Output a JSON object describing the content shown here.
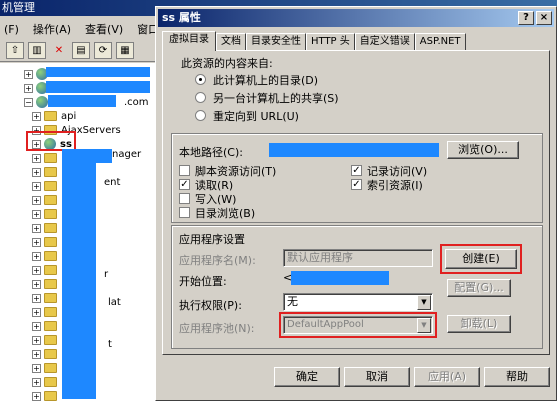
{
  "bg_window": {
    "title": "机管理",
    "menu": [
      "(F)",
      "操作(A)",
      "查看(V)",
      "窗口("
    ],
    "tree": {
      "domain_suffix": ".com",
      "items": [
        "api",
        "AjaxServers",
        "ss",
        "nager",
        "ent",
        "r",
        "lat",
        "t"
      ]
    }
  },
  "dialog": {
    "title": "ss 属性",
    "help_btn": "?",
    "close_btn": "×",
    "tabs": [
      "虚拟目录",
      "文档",
      "目录安全性",
      "HTTP 头",
      "自定义错误",
      "ASP.NET"
    ],
    "content_source_label": "此资源的内容来自:",
    "source_options": [
      {
        "label": "此计算机上的目录(D)",
        "selected": true
      },
      {
        "label": "另一台计算机上的共享(S)",
        "selected": false
      },
      {
        "label": "重定向到 URL(U)",
        "selected": false
      }
    ],
    "local_path_label": "本地路径(C):",
    "browse_btn": "浏览(O)...",
    "permissions": {
      "left": [
        {
          "label": "脚本资源访问(T)",
          "checked": false
        },
        {
          "label": "读取(R)",
          "checked": true
        },
        {
          "label": "写入(W)",
          "checked": false
        },
        {
          "label": "目录浏览(B)",
          "checked": false
        }
      ],
      "right": [
        {
          "label": "记录访问(V)",
          "checked": true
        },
        {
          "label": "索引资源(I)",
          "checked": true
        }
      ]
    },
    "app_settings_title": "应用程序设置",
    "app_name_label": "应用程序名(M):",
    "app_name_value": "默认应用程序",
    "start_point_label": "开始位置:",
    "start_point_value": "<",
    "exec_perm_label": "执行权限(P):",
    "exec_perm_value": "无",
    "app_pool_label": "应用程序池(N):",
    "app_pool_value": "DefaultAppPool",
    "create_btn": "创建(E)",
    "config_btn": "配置(G)...",
    "unload_btn": "卸载(L)",
    "footer": {
      "ok": "确定",
      "cancel": "取消",
      "apply": "应用(A)",
      "help": "帮助"
    },
    "colors": {
      "redaction": "#1e88ff",
      "highlight": "#e02020",
      "title_bar": "#0a246a"
    }
  }
}
